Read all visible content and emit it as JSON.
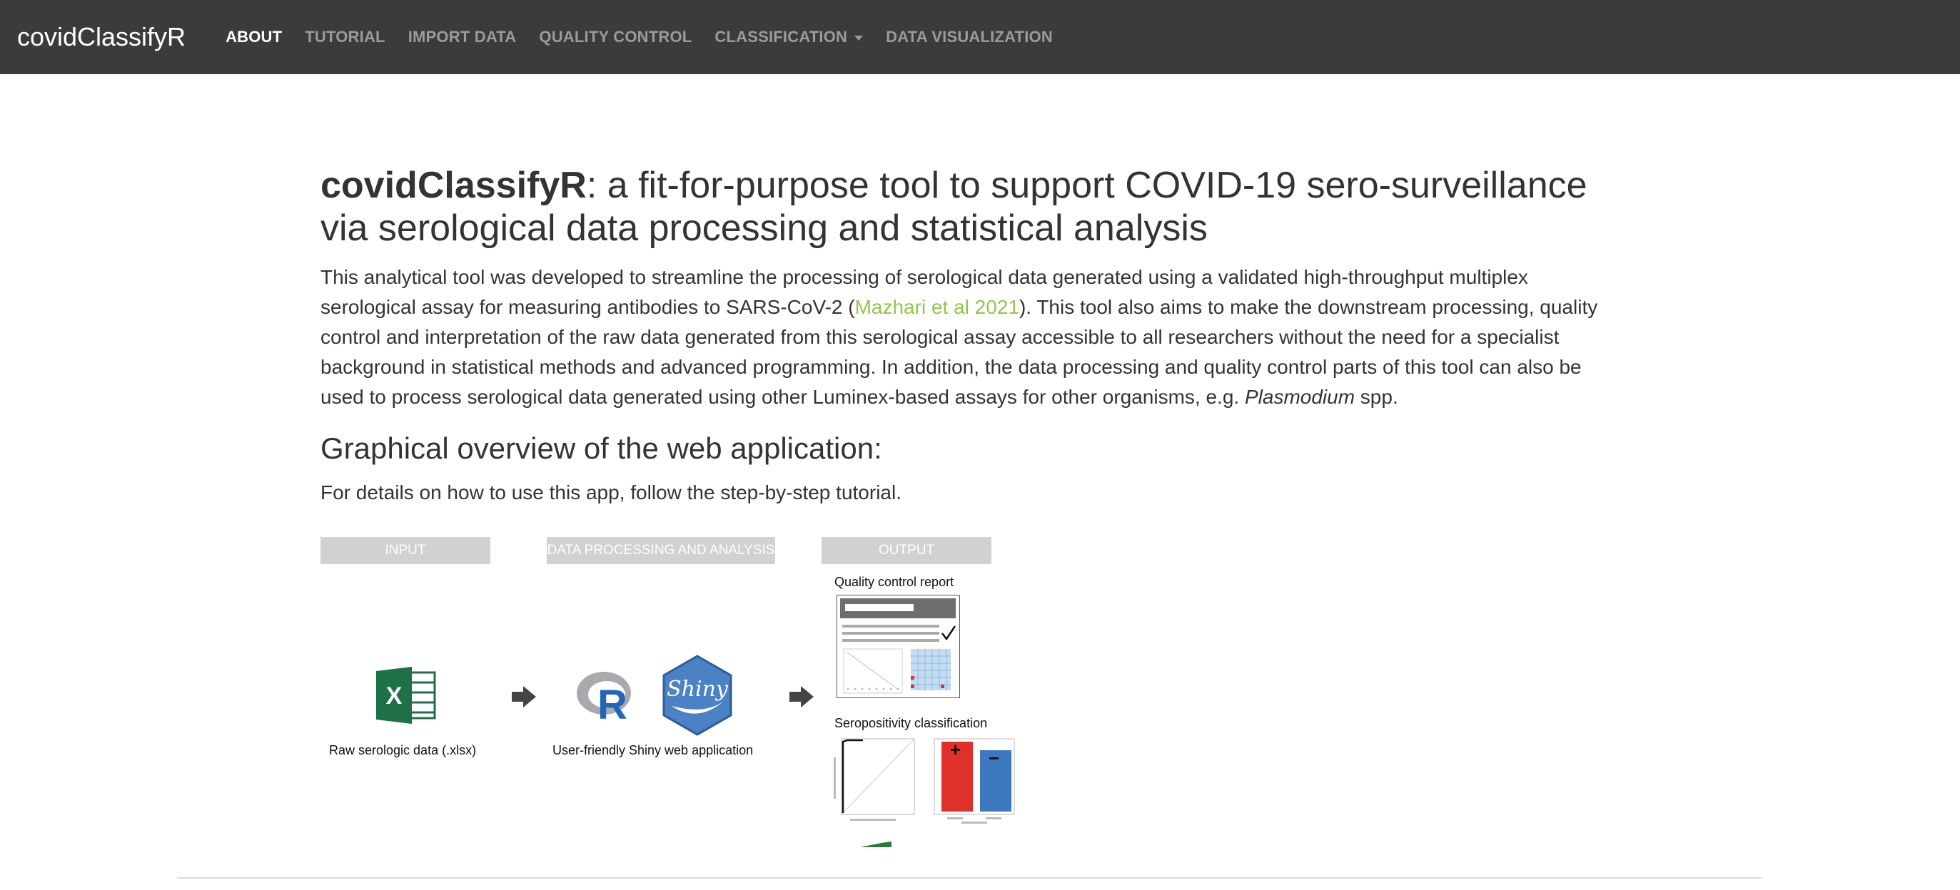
{
  "navbar": {
    "brand": "covidClassifyR",
    "items": [
      {
        "label": "ABOUT",
        "active": true
      },
      {
        "label": "TUTORIAL",
        "active": false
      },
      {
        "label": "IMPORT DATA",
        "active": false
      },
      {
        "label": "QUALITY CONTROL",
        "active": false
      },
      {
        "label": "CLASSIFICATION",
        "active": false,
        "dropdown": true
      },
      {
        "label": "DATA VISUALIZATION",
        "active": false
      }
    ]
  },
  "main": {
    "title_strong": "covidClassifyR",
    "title_rest": ": a fit-for-purpose tool to support COVID-19 sero-surveillance via serological data processing and statistical analysis",
    "intro_part1": "This analytical tool was developed to streamline the processing of serological data generated using a validated high-throughput multiplex serological assay for measuring antibodies to SARS-CoV-2 (",
    "intro_link": "Mazhari et al 2021",
    "intro_part2": "). This tool also aims to make the downstream processing, quality control and interpretation of the raw data generated from this serological assay accessible to all researchers without the need for a specialist background in statistical methods and advanced programming. In addition, the data processing and quality control parts of this tool can also be used to process serological data generated using other Luminex-based assays for other organisms, e.g. ",
    "intro_italic": "Plasmodium",
    "intro_part3": " spp.",
    "overview_heading": "Graphical overview of the web application:",
    "details_text": "For details on how to use this app, follow the step-by-step tutorial."
  },
  "diagram": {
    "headers": {
      "input": "INPUT",
      "processing": "DATA PROCESSING AND ANALYSIS",
      "output": "OUTPUT"
    },
    "input_caption": "Raw serologic data (.xlsx)",
    "processing_caption": "User-friendly Shiny web application",
    "excel_letter": "X",
    "r_letter": "R",
    "shiny_label": "Shiny",
    "qc_report_label": "Quality control report",
    "seropositivity_label": "Seropositivity classification",
    "plus_sign": "+",
    "minus_sign": "−"
  },
  "colors": {
    "navbar_bg": "#3b3c39",
    "link": "#93c54b",
    "header_box": "#d2d1d1",
    "excel_green": "#1e7145",
    "shiny_blue": "#4a82c3",
    "bar_red": "#e0302a",
    "bar_blue": "#3e78bf"
  },
  "icons": [
    "excel-icon",
    "r-logo-icon",
    "shiny-logo-icon",
    "arrow-right-icon",
    "checkmark-icon",
    "caret-down-icon"
  ]
}
